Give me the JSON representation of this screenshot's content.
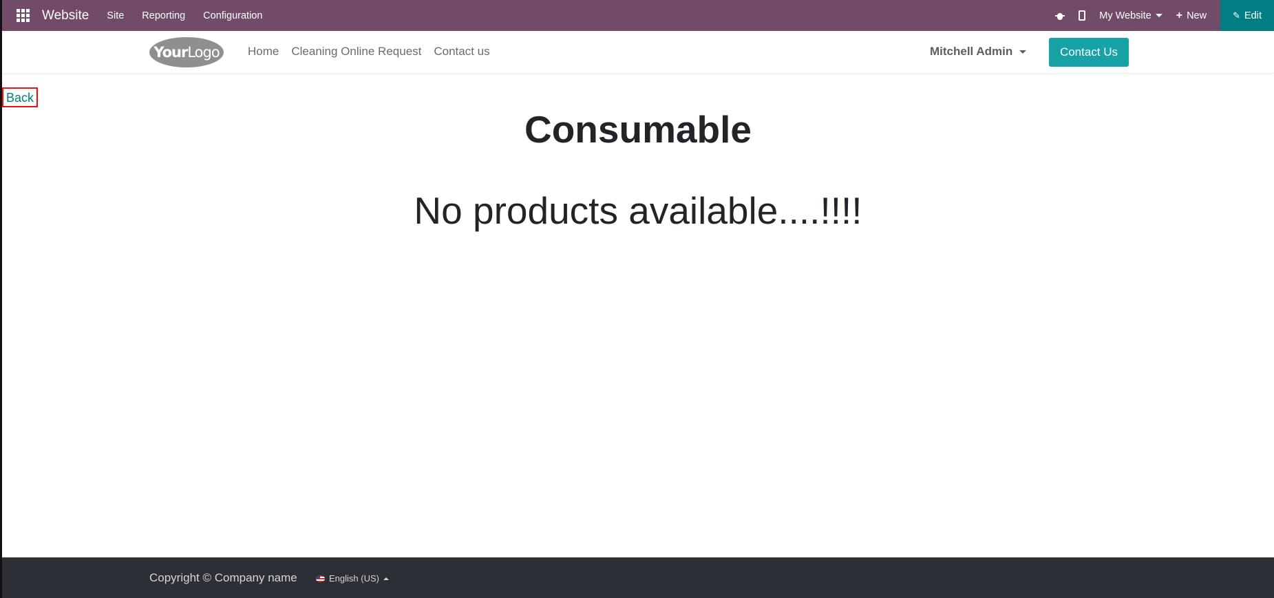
{
  "admin_bar": {
    "brand": "Website",
    "menus": [
      "Site",
      "Reporting",
      "Configuration"
    ],
    "website_selector": "My Website",
    "new_label": "New",
    "edit_label": "Edit"
  },
  "header": {
    "logo_text_bold": "Your",
    "logo_text": "Logo",
    "nav": [
      "Home",
      "Cleaning Online Request",
      "Contact us"
    ],
    "user": "Mitchell Admin",
    "contact_button": "Contact Us"
  },
  "main": {
    "back_label": "Back",
    "title": "Consumable",
    "empty_message": "No products available....!!!!"
  },
  "footer": {
    "copyright": "Copyright © Company name",
    "language": "English (US)"
  },
  "colors": {
    "admin_bar": "#714b67",
    "edit_button": "#017e84",
    "contact_button": "#17a2a8",
    "footer": "#2d2f37"
  }
}
